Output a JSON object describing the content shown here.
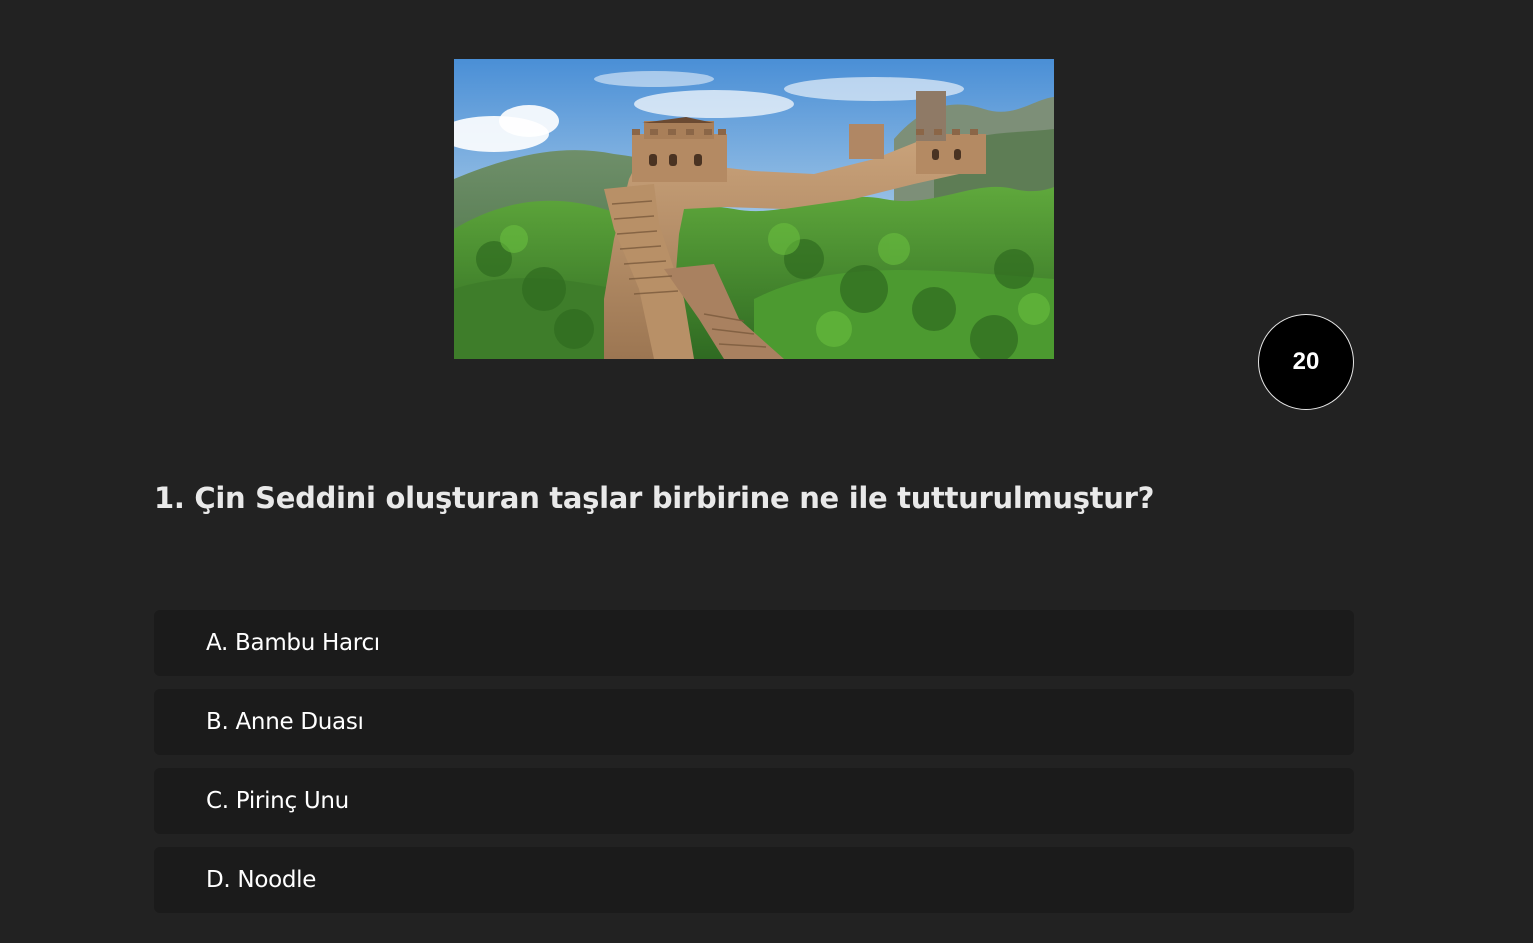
{
  "quiz": {
    "timer": "20",
    "question": "1. Çin Seddini oluşturan taşlar birbirine ne ile tutturulmuştur?",
    "answers": [
      {
        "label": "A. Bambu Harcı"
      },
      {
        "label": "B. Anne Duası"
      },
      {
        "label": "C. Pirinç Unu"
      },
      {
        "label": "D. Noodle"
      }
    ]
  }
}
